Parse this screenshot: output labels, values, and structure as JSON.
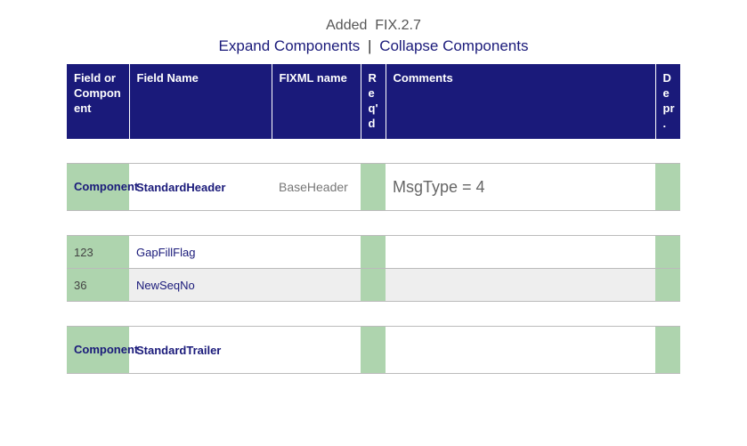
{
  "header": {
    "added_prefix": "Added",
    "added_version": "FIX.2.7",
    "expand_label": "Expand Components",
    "collapse_label": "Collapse Components"
  },
  "columns": {
    "c1": "Field or Component",
    "c2": "Field Name",
    "c3": "FIXML name",
    "c4": "Req'd",
    "c5": "Comments",
    "c6": "Depr."
  },
  "rows": [
    {
      "kind": "component",
      "col1": "Component",
      "field_name": "StandardHeader",
      "fixml": "BaseHeader",
      "reqd": "",
      "comments": "MsgType = 4",
      "depr": ""
    },
    {
      "kind": "field",
      "col1": "123",
      "field_name": "GapFillFlag",
      "fixml": "",
      "reqd": "",
      "comments": "",
      "depr": ""
    },
    {
      "kind": "field",
      "col1": "36",
      "field_name": "NewSeqNo",
      "fixml": "",
      "reqd": "",
      "comments": "",
      "depr": ""
    },
    {
      "kind": "component",
      "col1": "Component",
      "field_name": "StandardTrailer",
      "fixml": "",
      "reqd": "",
      "comments": "",
      "depr": ""
    }
  ]
}
